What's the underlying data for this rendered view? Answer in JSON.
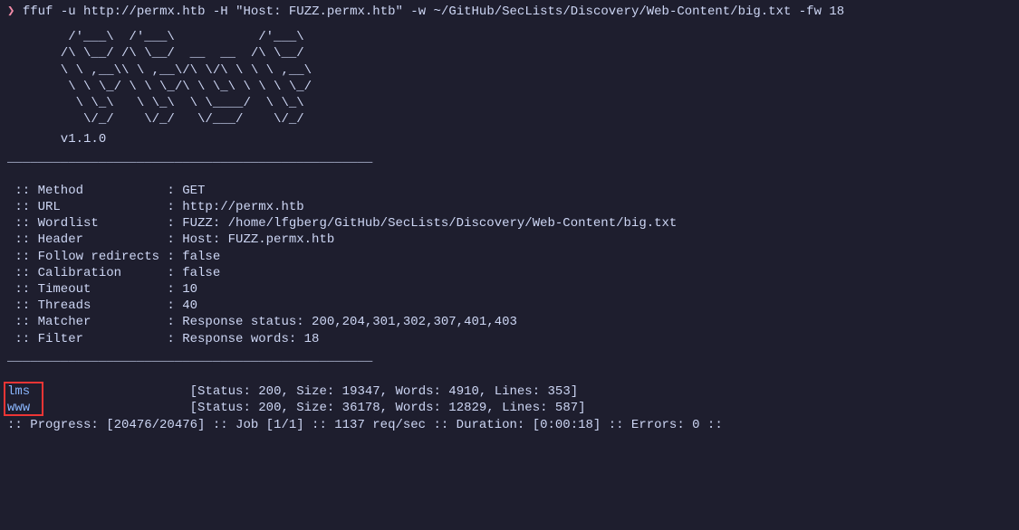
{
  "command": {
    "prompt": "❯",
    "text": " ffuf -u http://permx.htb -H \"Host: FUZZ.permx.htb\" -w ~/GitHub/SecLists/Discovery/Web-Content/big.txt -fw 18"
  },
  "ascii": "        /'___\\  /'___\\           /'___\\\n       /\\ \\__/ /\\ \\__/  __  __  /\\ \\__/\n       \\ \\ ,__\\\\ \\ ,__\\/\\ \\/\\ \\ \\ \\ ,__\\\n        \\ \\ \\_/ \\ \\ \\_/\\ \\ \\_\\ \\ \\ \\ \\_/\n         \\ \\_\\   \\ \\_\\  \\ \\____/  \\ \\_\\\n          \\/_/    \\/_/   \\/___/    \\/_/",
  "version": "       v1.1.0",
  "divider": "________________________________________________",
  "config": [
    " :: Method           : GET",
    " :: URL              : http://permx.htb",
    " :: Wordlist         : FUZZ: /home/lfgberg/GitHub/SecLists/Discovery/Web-Content/big.txt",
    " :: Header           : Host: FUZZ.permx.htb",
    " :: Follow redirects : false",
    " :: Calibration      : false",
    " :: Timeout          : 10",
    " :: Threads          : 40",
    " :: Matcher          : Response status: 200,204,301,302,307,401,403",
    " :: Filter           : Response words: 18"
  ],
  "results": [
    {
      "name": "lms",
      "stats": "                     [Status: 200, Size: 19347, Words: 4910, Lines: 353]"
    },
    {
      "name": "www",
      "stats": "                     [Status: 200, Size: 36178, Words: 12829, Lines: 587]"
    }
  ],
  "progress": ":: Progress: [20476/20476] :: Job [1/1] :: 1137 req/sec :: Duration: [0:00:18] :: Errors: 0 ::"
}
